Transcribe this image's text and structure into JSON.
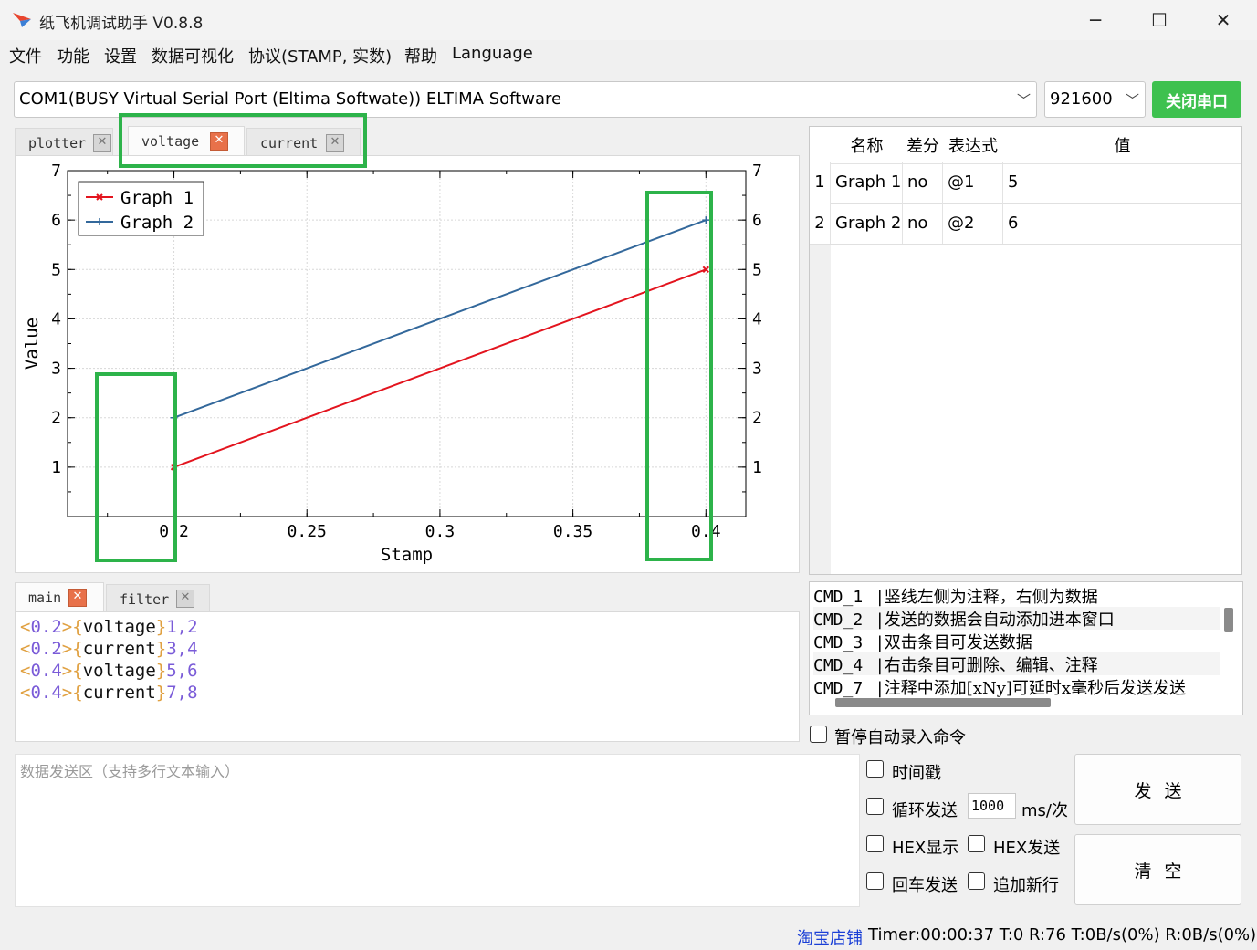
{
  "app": {
    "title": "纸飞机调试助手 V0.8.8"
  },
  "window_controls": {
    "minimize": "─",
    "maximize": "☐",
    "close": "✕"
  },
  "menu": [
    "文件",
    "功能",
    "设置",
    "数据可视化",
    "协议(STAMP, 实数)",
    "帮助",
    "Language"
  ],
  "port": {
    "selected": "COM1(BUSY  Virtual Serial Port (Eltima Softwate)) ELTIMA Software",
    "baud": "921600",
    "close_button": "关闭串口"
  },
  "plot_tabs": [
    {
      "label": "plotter"
    },
    {
      "label": "voltage"
    },
    {
      "label": "current"
    }
  ],
  "chart_data": {
    "type": "line",
    "xlabel": "Stamp",
    "ylabel": "Value",
    "xlim": [
      0.16,
      0.415
    ],
    "ylim": [
      0,
      7
    ],
    "x_ticks": [
      "0.2",
      "0.25",
      "0.3",
      "0.35",
      "0.4"
    ],
    "x_tick_values": [
      0.2,
      0.25,
      0.3,
      0.35,
      0.4
    ],
    "y_ticks": [
      "1",
      "2",
      "3",
      "4",
      "5",
      "6",
      "7"
    ],
    "y_tick_values": [
      1,
      2,
      3,
      4,
      5,
      6,
      7
    ],
    "grid": true,
    "legend_position": "top-left",
    "series": [
      {
        "name": "Graph 1",
        "color": "#e3141e",
        "marker": "x",
        "x": [
          0.2,
          0.4
        ],
        "y": [
          1,
          5
        ]
      },
      {
        "name": "Graph 2",
        "color": "#33689b",
        "marker": "+",
        "x": [
          0.2,
          0.4
        ],
        "y": [
          2,
          6
        ]
      }
    ]
  },
  "table": {
    "headers": [
      "名称",
      "差分",
      "表达式",
      "值"
    ],
    "rows": [
      {
        "index": "1",
        "name": "Graph 1",
        "diff": "no",
        "expr": "@1",
        "value": "5"
      },
      {
        "index": "2",
        "name": "Graph 2",
        "diff": "no",
        "expr": "@2",
        "value": "6"
      }
    ]
  },
  "log_tabs": [
    {
      "label": "main"
    },
    {
      "label": "filter"
    }
  ],
  "log_lines": [
    {
      "stamp": "0.2",
      "name": "voltage",
      "values": "1,2"
    },
    {
      "stamp": "0.2",
      "name": "current",
      "values": "3,4"
    },
    {
      "stamp": "0.4",
      "name": "voltage",
      "values": "5,6"
    },
    {
      "stamp": "0.4",
      "name": "current",
      "values": "7,8"
    }
  ],
  "commands": [
    {
      "id": "CMD_1",
      "text": "竖线左侧为注释，右侧为数据"
    },
    {
      "id": "CMD_2",
      "text": "发送的数据会自动添加进本窗口"
    },
    {
      "id": "CMD_3",
      "text": "双击条目可发送数据"
    },
    {
      "id": "CMD_4",
      "text": "右击条目可删除、编辑、注释"
    },
    {
      "id": "CMD_7",
      "text": "注释中添加[xNy]可延时x毫秒后发送发送"
    }
  ],
  "send": {
    "placeholder": "数据发送区（支持多行文本输入）",
    "pause_record": "暂停自动录入命令",
    "timestamp": "时间戳",
    "loop_send": "循环发送",
    "interval": "1000",
    "interval_unit": "ms/次",
    "hex_display": "HEX显示",
    "hex_send": "HEX发送",
    "enter_send": "回车发送",
    "append_newline": "追加新行",
    "send_button": "发送",
    "clear_button": "清空"
  },
  "status": {
    "shop_link": "淘宝店铺",
    "info": "Timer:00:00:37  T:0 R:76   T:0B/s(0%) R:0B/s(0%)"
  },
  "annotation_color": "#2db34a"
}
